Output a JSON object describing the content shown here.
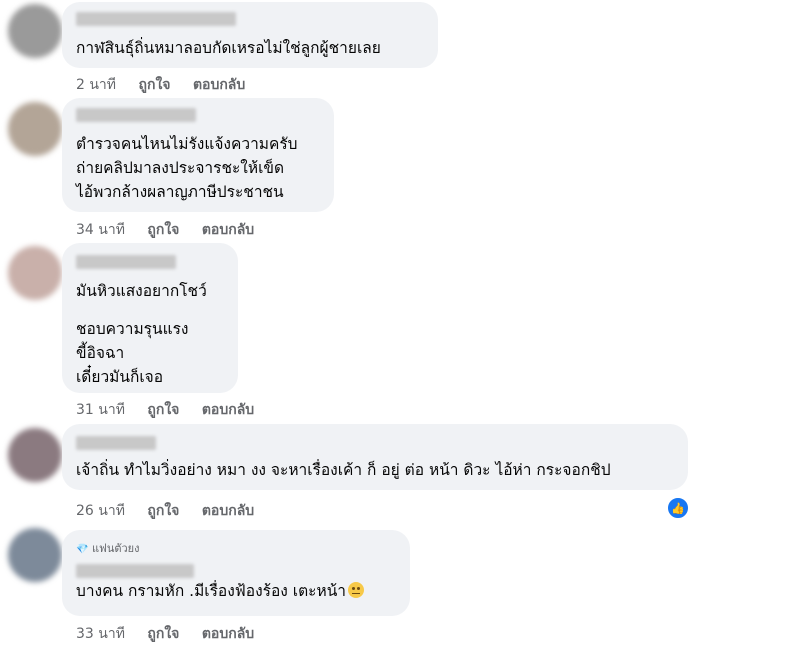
{
  "actions": {
    "like": "ถูกใจ",
    "reply": "ตอบกลับ"
  },
  "colors": {
    "bubble": "#f0f2f5",
    "meta": "#65676b",
    "reaction": "#1877f2"
  },
  "comments": [
    {
      "lines": [
        "กาฬสินธุ์ถิ่นหมาลอบกัดเหรอไม่ใช่ลูกผู้ชายเลย"
      ],
      "time": "2 นาที"
    },
    {
      "lines": [
        "ตำรวจคนไหนไม่รังแจ้งความครับ",
        "ถ่ายคลิปมาลงประจารชะให้เข็ด",
        "ไอ้พวกล้างผลาญภาษีประชาชน"
      ],
      "time": "34 นาที"
    },
    {
      "lines": [
        "มันหิวแสงอยากโชว์",
        "ชอบความรุนแรง",
        "ขี้อิจฉา",
        "เดี๋ยวมันก็เจอ"
      ],
      "time": "31 นาที"
    },
    {
      "lines": [
        "เจ้าถิ่น ทำไมวิ่งอย่าง หมา งง จะหาเรื่องเค้า ก็ อยู่ ต่อ หน้า ดิวะ ไอ้ห่า กระจอกชิป"
      ],
      "time": "26 นาที",
      "reaction_icon": "like-icon",
      "reaction_glyph": "👍"
    },
    {
      "badge": "แฟนตัวยง",
      "badge_icon": "diamond-icon",
      "badge_glyph": "💎",
      "lines": [
        "บางคน กรามหัก .มีเรื่องฟ้องร้อง เตะหน้า"
      ],
      "emoji_icon": "neutral-face-icon",
      "time": "33 นาที"
    }
  ]
}
